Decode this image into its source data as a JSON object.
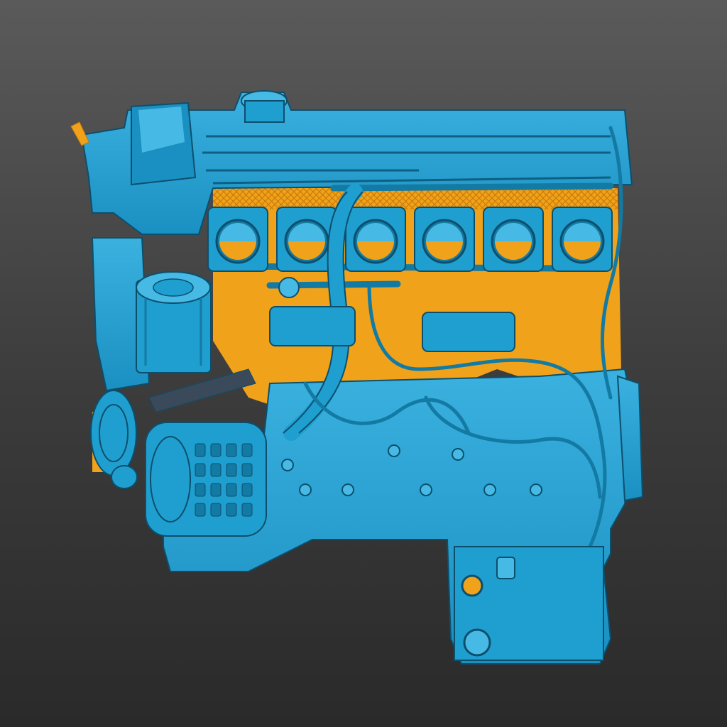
{
  "viewer": {
    "background_top": "#5a5a5a",
    "background_bottom": "#2a2a2a"
  },
  "model": {
    "name": "engine-scan",
    "deviation_colors": {
      "surface": "#1f9fd0",
      "surface_light": "#46b9e4",
      "surface_dark": "#137aa4",
      "outline": "#0c4f6d",
      "backface": "#f0a21a"
    },
    "throttle_body_count": 6
  }
}
